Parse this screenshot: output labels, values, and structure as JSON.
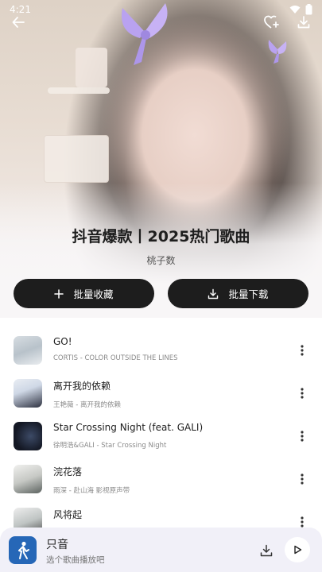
{
  "status": {
    "time": "4:21"
  },
  "playlist": {
    "title": "抖音爆款丨2025热门歌曲",
    "author": "桃子数"
  },
  "actions": {
    "collect_label": "批量收藏",
    "download_label": "批量下载"
  },
  "songs": [
    {
      "title": "GO!",
      "subtitle": "CORTIS - COLOR OUTSIDE THE LINES"
    },
    {
      "title": "离开我的依赖",
      "subtitle": "王艳薇 - 离开我的依赖"
    },
    {
      "title": "Star Crossing Night (feat. GALI)",
      "subtitle": "徐明浩&GALI - Star Crossing Night"
    },
    {
      "title": "浣花落",
      "subtitle": "雨深 - 赴山海 影视原声带"
    },
    {
      "title": "风将起",
      "subtitle": ""
    }
  ],
  "player": {
    "title": "只音",
    "subtitle": "选个歌曲播放吧"
  },
  "colors": {
    "accent_dark": "#1d1d1d",
    "player_bg": "#f1f0f8",
    "player_art": "#2667b7",
    "bow": "#b9a2f0"
  }
}
